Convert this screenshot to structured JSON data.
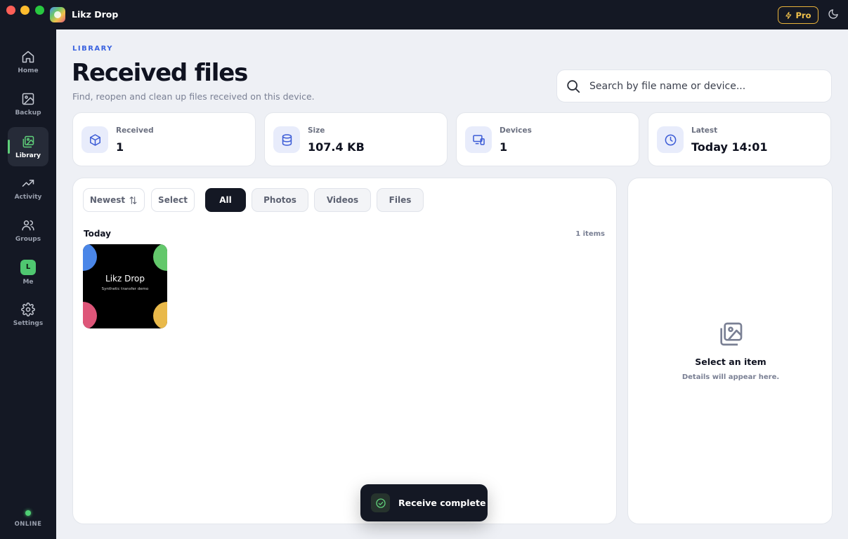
{
  "window": {
    "app_title": "Likz Drop",
    "pro_label": "Pro"
  },
  "sidebar": {
    "items": [
      {
        "label": "Home",
        "icon": "home-icon"
      },
      {
        "label": "Backup",
        "icon": "image-backup-icon"
      },
      {
        "label": "Library",
        "icon": "gallery-icon",
        "active": true
      },
      {
        "label": "Activity",
        "icon": "trending-up-icon"
      },
      {
        "label": "Groups",
        "icon": "users-icon"
      },
      {
        "label": "Me",
        "icon": "avatar",
        "avatar_letter": "L"
      },
      {
        "label": "Settings",
        "icon": "gear-icon"
      }
    ],
    "status": "ONLINE"
  },
  "header": {
    "eyebrow": "LIBRARY",
    "title": "Received files",
    "subtitle": "Find, reopen and clean up files received on this device.",
    "search_placeholder": "Search by file name or device..."
  },
  "stats": [
    {
      "label": "Received",
      "value": "1",
      "icon": "package-icon"
    },
    {
      "label": "Size",
      "value": "107.4 KB",
      "icon": "database-icon"
    },
    {
      "label": "Devices",
      "value": "1",
      "icon": "devices-icon"
    },
    {
      "label": "Latest",
      "value": "Today 14:01",
      "icon": "clock-icon"
    }
  ],
  "toolbar": {
    "sort_label": "Newest",
    "select_label": "Select",
    "filters": [
      "All",
      "Photos",
      "Videos",
      "Files"
    ],
    "active_filter": "All"
  },
  "groups": [
    {
      "title": "Today",
      "count_label": "1 items",
      "items": [
        {
          "thumb_title": "Likz Drop",
          "thumb_subtitle": "Synthetic transfer demo"
        }
      ]
    }
  ],
  "details": {
    "title": "Select an item",
    "subtitle": "Details will appear here."
  },
  "toast": {
    "text": "Receive complete"
  },
  "colors": {
    "accent": "#3b63e0",
    "sidebar_bg": "#141824",
    "pro": "#e8b23a",
    "online": "#4fcf74"
  }
}
